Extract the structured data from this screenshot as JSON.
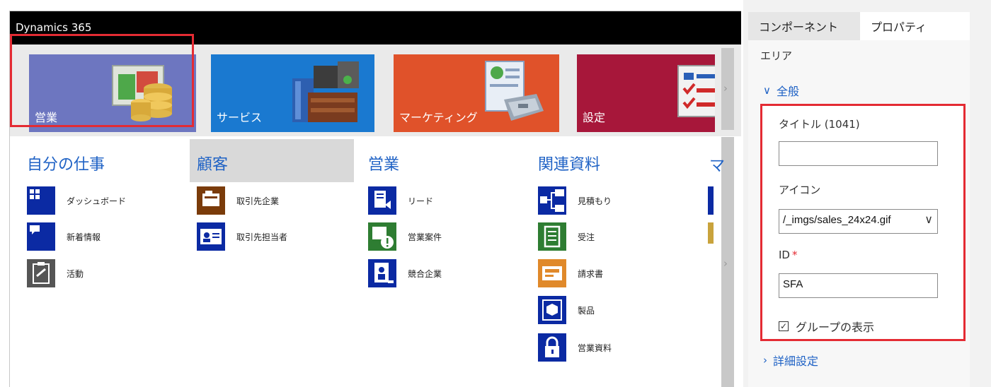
{
  "app": {
    "title": "Dynamics 365"
  },
  "tiles": [
    {
      "label": "営業",
      "color": "#6d76c0"
    },
    {
      "label": "サービス",
      "color": "#1a79d0"
    },
    {
      "label": "マーケティング",
      "color": "#e0522a"
    },
    {
      "label": "設定",
      "color": "#a7173a"
    }
  ],
  "groups": [
    {
      "title": "自分の仕事",
      "items": [
        "ダッシュボード",
        "新着情報",
        "活動"
      ]
    },
    {
      "title": "顧客",
      "items": [
        "取引先企業",
        "取引先担当者"
      ]
    },
    {
      "title": "営業",
      "items": [
        "リード",
        "営業案件",
        "競合企業"
      ]
    },
    {
      "title": "関連資料",
      "items": [
        "見積もり",
        "受注",
        "請求書",
        "製品",
        "営業資料"
      ]
    }
  ],
  "cut_group_head": "マ",
  "panel": {
    "tabs": [
      "コンポーネント",
      "プロパティ"
    ],
    "area_label": "エリア",
    "section_general": "全般",
    "title_label": "タイトル (1041)",
    "title_value": "",
    "icon_label": "アイコン",
    "icon_value": "/_imgs/sales_24x24.gif",
    "id_label": "ID",
    "id_required_mark": "*",
    "id_value": "SFA",
    "show_groups_label": "グループの表示",
    "show_groups_checked": true,
    "advanced_label": "詳細設定"
  },
  "colors": {
    "accent_blue": "#1f62c5",
    "highlight_red": "#e42b33",
    "icon_navy": "#0b2aa3"
  }
}
